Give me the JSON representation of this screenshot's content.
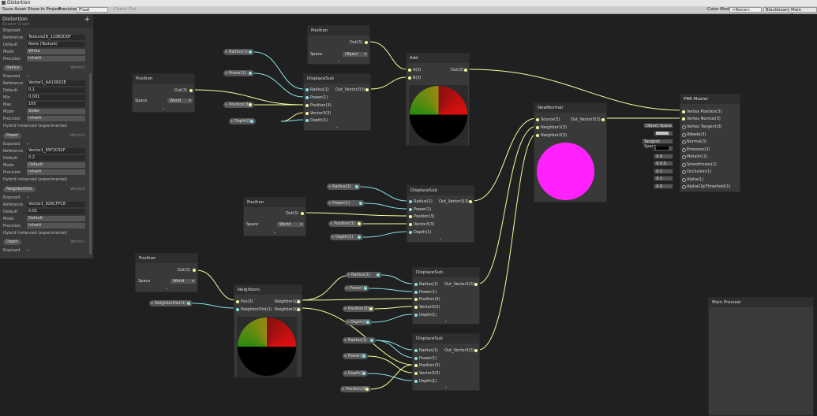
{
  "window": {
    "title": "Distortion"
  },
  "toolbar": {
    "save_asset": "Save Asset",
    "show_in_project": "Show In Project",
    "precision_label": "Precision",
    "precision_value": "Float",
    "check_out": "Check Out",
    "color_mode_label": "Color Mode",
    "color_mode_value": "<None>",
    "blackboard": "Blackboard",
    "main_preview": "Main Preview"
  },
  "blackboard": {
    "title": "Distortion",
    "subtitle": "Shader Graph",
    "add": "+",
    "rows": [
      {
        "label": "Exposed",
        "value": ""
      },
      {
        "label": "Reference",
        "value": "Texture2D_110B3D0F"
      },
      {
        "label": "Default",
        "value": "None (Texture)"
      },
      {
        "label": "Mode",
        "value": "White"
      },
      {
        "label": "Precision",
        "value": "Inherit"
      }
    ],
    "props": [
      {
        "name": "Radius",
        "type": "Vector1",
        "rows": [
          {
            "label": "Exposed",
            "value": "✓"
          },
          {
            "label": "Reference",
            "value": "Vector1_AA13822E"
          },
          {
            "label": "Default",
            "value": "0.1"
          },
          {
            "label": "Min",
            "value": "0.001"
          },
          {
            "label": "Max",
            "value": "100"
          },
          {
            "label": "Mode",
            "value": "Slider"
          },
          {
            "label": "Precision",
            "value": "Inherit"
          }
        ],
        "hybrid": "Hybrid Instanced (experimental)"
      },
      {
        "name": "Power",
        "type": "Vector1",
        "rows": [
          {
            "label": "Exposed",
            "value": "✓"
          },
          {
            "label": "Reference",
            "value": "Vector1_65F2C91F"
          },
          {
            "label": "Default",
            "value": "0.2"
          },
          {
            "label": "Mode",
            "value": "Default"
          },
          {
            "label": "Precision",
            "value": "Inherit"
          }
        ],
        "hybrid": "Hybrid Instanced (experimental)"
      },
      {
        "name": "NeighborDist",
        "type": "Vector1",
        "rows": [
          {
            "label": "Exposed",
            "value": "✓"
          },
          {
            "label": "Reference",
            "value": "Vector1_926CFFC8"
          },
          {
            "label": "Default",
            "value": "0.01"
          },
          {
            "label": "Mode",
            "value": "Default"
          },
          {
            "label": "Precision",
            "value": "Inherit"
          }
        ],
        "hybrid": "Hybrid Instanced (experimental)"
      },
      {
        "name": "Depth",
        "type": "Vector1",
        "rows": [
          {
            "label": "Exposed",
            "value": "✓"
          }
        ],
        "hybrid": ""
      }
    ]
  },
  "nodes": {
    "position": {
      "title": "Position",
      "out": "Out(3)",
      "space_label": "Space",
      "space_world": "World",
      "space_object": "Object"
    },
    "displace": {
      "title": "DisplaceSub",
      "out": "Out_Vector3(3)",
      "inputs": [
        "Radius(1)",
        "Power(1)",
        "Position(3)",
        "Vector3(3)",
        "Depth(1)"
      ]
    },
    "add": {
      "title": "Add",
      "a": "A(3)",
      "b": "B(3)",
      "out": "Out(3)"
    },
    "newnormal": {
      "title": "NewNormal",
      "inputs": [
        "Source(3)",
        "Neighbor1(3)",
        "Neighbor2(3)"
      ],
      "out": "Out_Vector3(3)"
    },
    "neighbors": {
      "title": "Neighbors",
      "inputs": [
        "Pos(3)",
        "NeighborDist(1)"
      ],
      "outs": [
        "Neighbor1(3)",
        "Neighbor2(3)"
      ]
    },
    "pbr": {
      "title": "PBR Master",
      "inputs": [
        "Vertex Position(3)",
        "Vertex Normal(3)",
        "Vertex Tangent(3)",
        "Albedo(3)",
        "Normal(3)",
        "Emission(3)",
        "Metallic(1)",
        "Smoothness(1)",
        "Occlusion(1)",
        "Alpha(1)",
        "AlphaClipThreshold(1)"
      ],
      "object_space": "Object Space",
      "tangent_space": "Tangent Space",
      "x": "X",
      "metallic": "0",
      "smoothness": "0.5",
      "occlusion": "1",
      "alpha": "1",
      "alphaclip": "0"
    },
    "pills": {
      "radius": "Radius(1)",
      "power": "Power(1)",
      "position": "Position(3)",
      "depth": "Depth(1)",
      "neighbordist": "NeighborDist(1)"
    }
  },
  "main_preview": {
    "title": "Main Preview"
  },
  "colors": {
    "vec3_port": "#f6ff9a",
    "vec1_port": "#84e4e7",
    "magenta": "#ff22ff"
  }
}
